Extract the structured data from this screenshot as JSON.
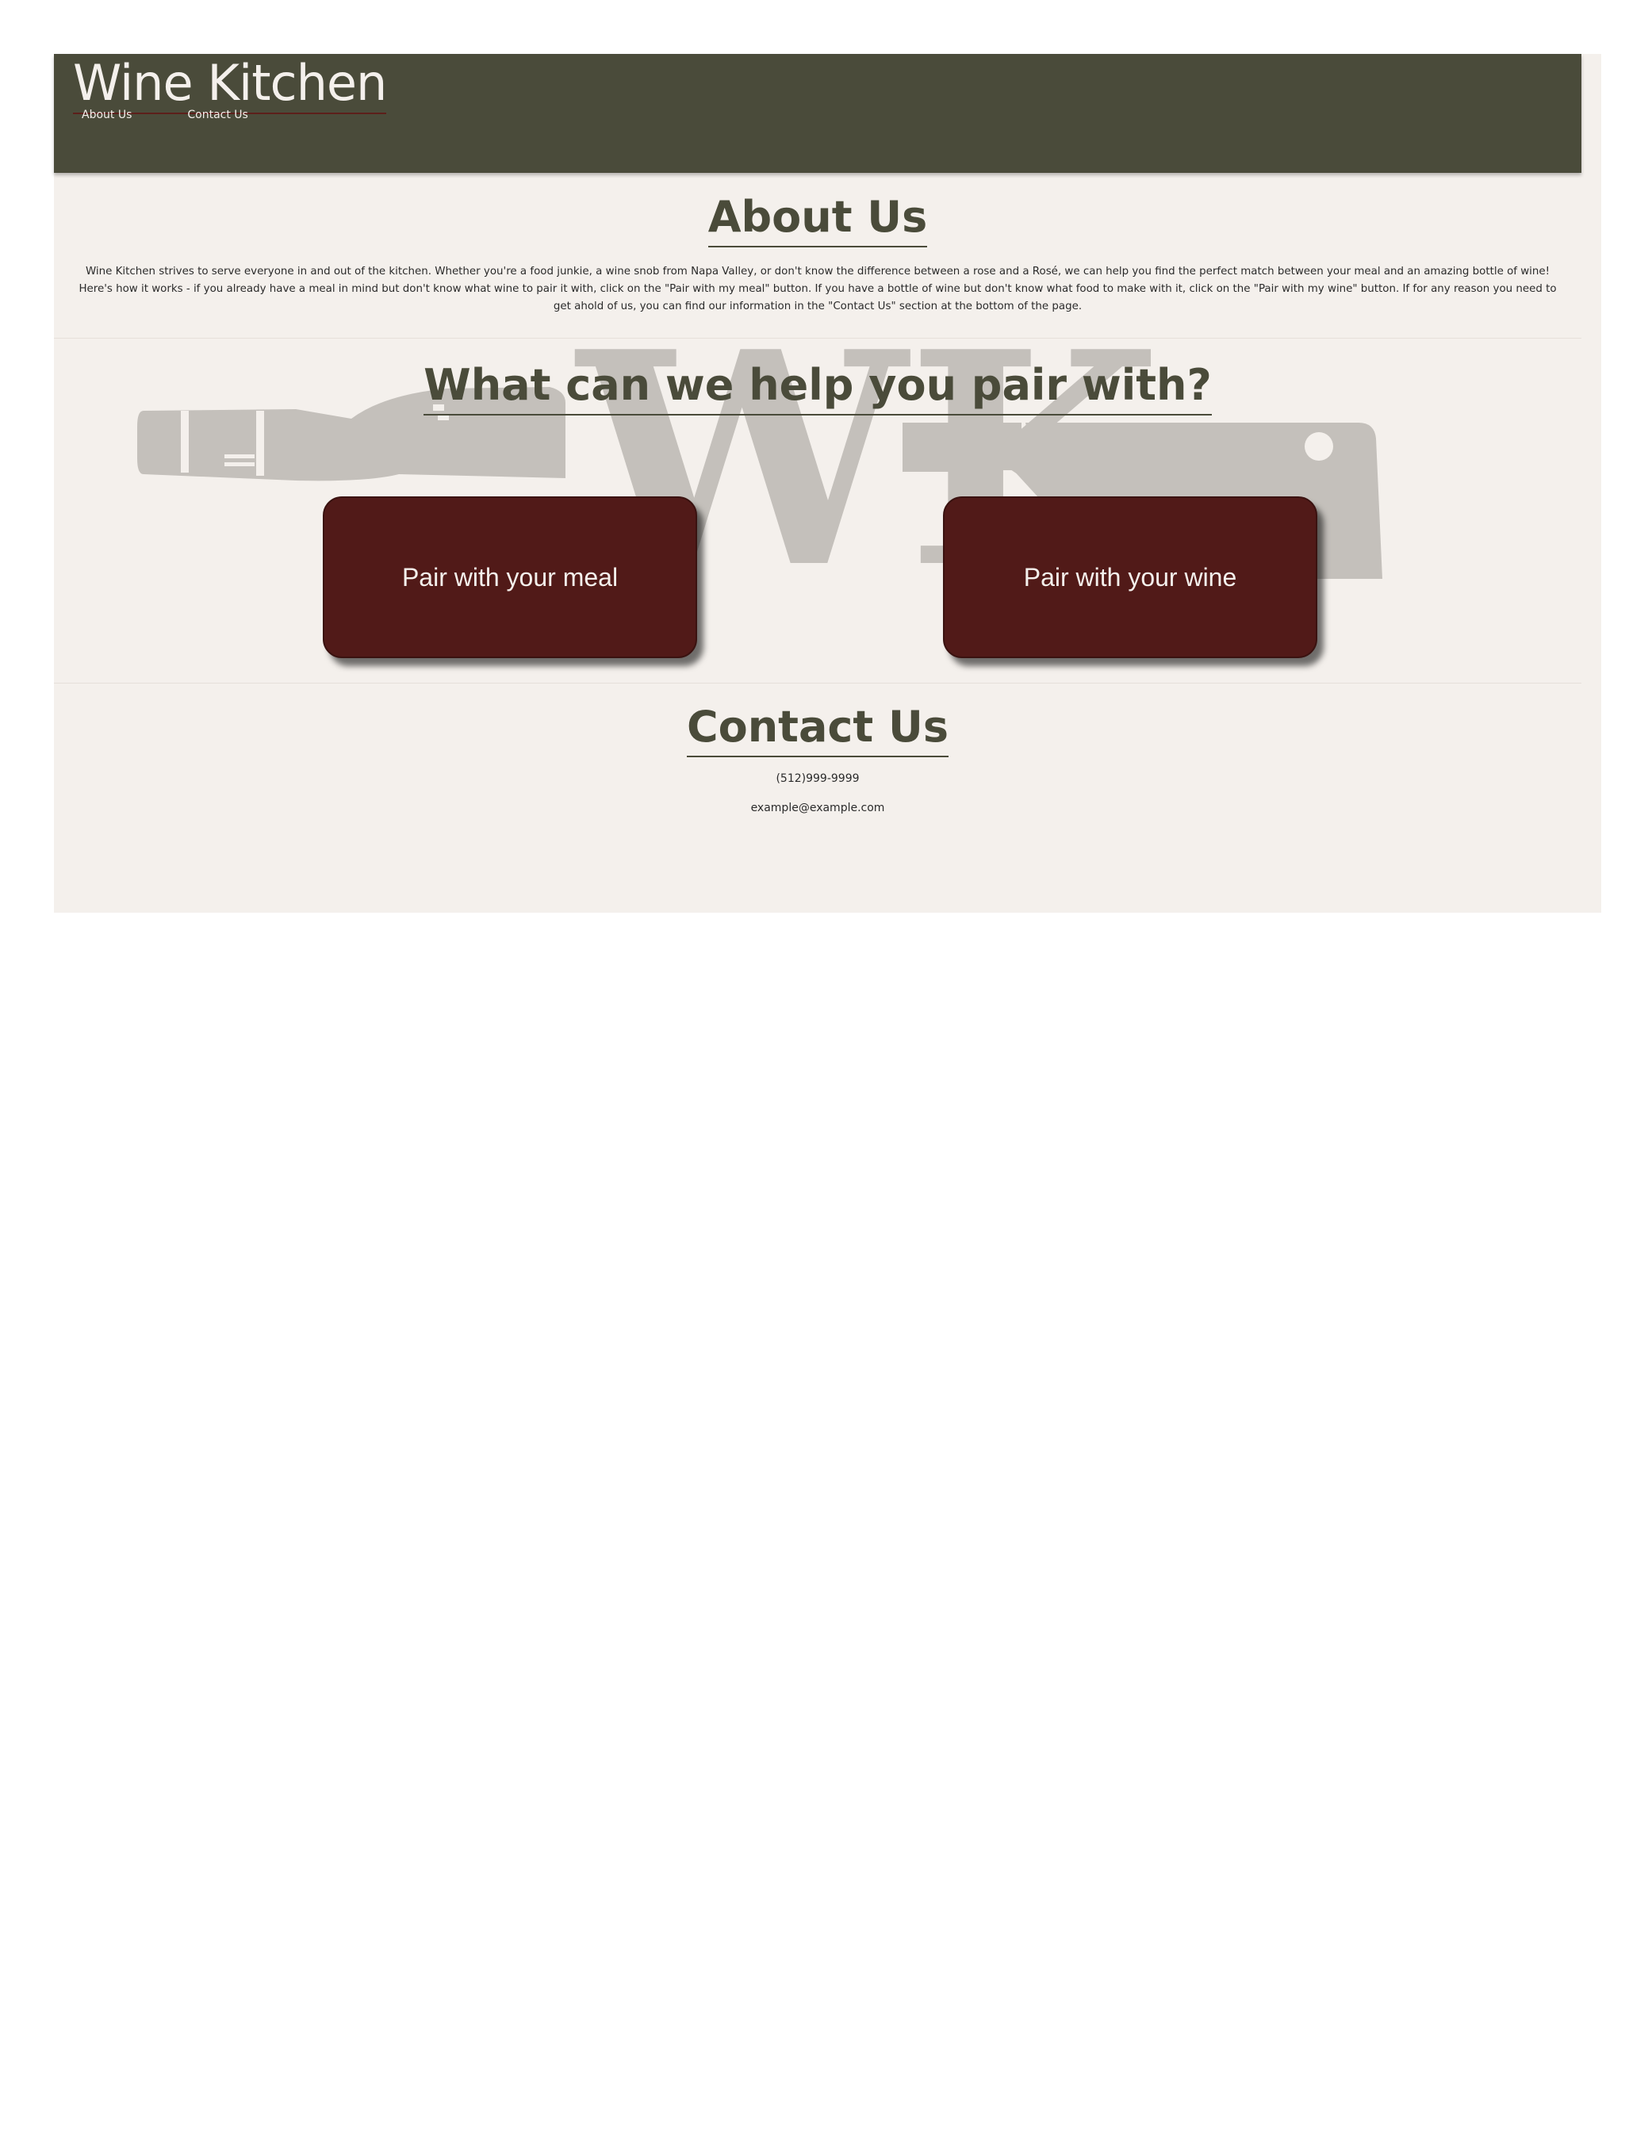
{
  "header": {
    "brand": "Wine Kitchen",
    "nav": [
      {
        "label": "About Us"
      },
      {
        "label": "Contact Us"
      }
    ]
  },
  "about": {
    "title": "About Us",
    "text": "Wine Kitchen strives to serve everyone in and out of the kitchen. Whether you're a food junkie, a wine snob from Napa Valley, or don't know the difference between a rose and a Rosé, we can help you find the perfect match between your meal and an amazing bottle of wine! Here's how it works - if you already have a meal in mind but don't know what wine to pair it with, click on the \"Pair with my meal\" button. If you have a bottle of wine but don't know what food to make with it, click on the \"Pair with my wine\" button. If for any reason you need to get ahold of us, you can find our information in the \"Contact Us\" section at the bottom of the page."
  },
  "pair": {
    "title": "What can we help you pair with?",
    "meal_button": "Pair with your meal",
    "wine_button": "Pair with your wine",
    "watermark_text": "WK"
  },
  "contact": {
    "title": "Contact Us",
    "phone": "(512)999-9999",
    "email": "example@example.com"
  },
  "colors": {
    "header_bg": "#4a4b3a",
    "page_bg": "#f4f0ec",
    "button_bg": "#511a18",
    "heading": "#4a4b3a",
    "watermark": "#c4c0bb"
  }
}
